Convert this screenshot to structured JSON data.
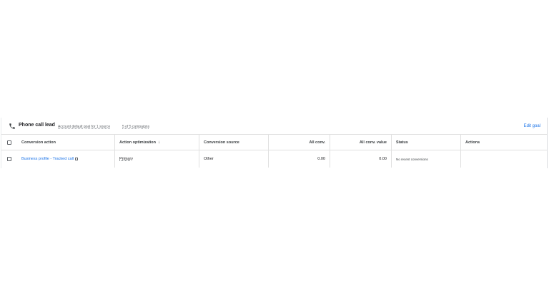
{
  "goal": {
    "title": "Phone call lead",
    "default_goal_text": "Account default goal for 1 source",
    "campaigns_text": "5 of 5 campaigns",
    "edit_label": "Edit goal"
  },
  "table": {
    "headers": {
      "conversion_action": "Conversion action",
      "action_optimization": "Action optimization",
      "sort_arrow": "↓",
      "conversion_source": "Conversion source",
      "all_conv": "All conv.",
      "all_conv_value": "All conv. value",
      "status": "Status",
      "actions": "Actions"
    },
    "rows": [
      {
        "conversion_action": "Business profile - Tracked call",
        "action_optimization": "Primary",
        "conversion_source": "Other",
        "all_conv": "0.00",
        "all_conv_value": "0.00",
        "status": "No recent conversions",
        "actions": ""
      }
    ]
  }
}
